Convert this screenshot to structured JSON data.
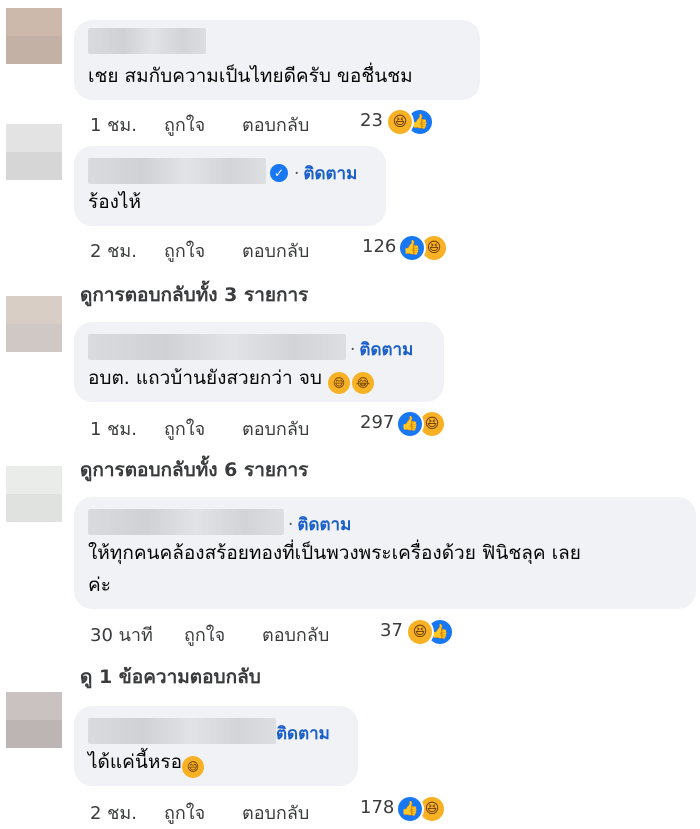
{
  "comments": [
    {
      "text": "เชย สมกับความเป็นไทยดีครับ ขอชื่นชม",
      "time": "1 ชม.",
      "like": "ถูกใจ",
      "reply": "ตอบกลับ",
      "reaction_count": "23"
    },
    {
      "follow": "ติดตาม",
      "text": "ร้องไห้",
      "time": "2 ชม.",
      "like": "ถูกใจ",
      "reply": "ตอบกลับ",
      "reaction_count": "126",
      "view_replies": "ดูการตอบกลับทั้ง 3 รายการ"
    },
    {
      "follow": "ติดตาม",
      "text": "อบต. แถวบ้านยังสวยกว่า จบ",
      "time": "1 ชม.",
      "like": "ถูกใจ",
      "reply": "ตอบกลับ",
      "reaction_count": "297",
      "view_replies": "ดูการตอบกลับทั้ง 6 รายการ"
    },
    {
      "follow": "ติดตาม",
      "text_line1": "ให้ทุกคนคล้องสร้อยทองที่เป็นพวงพระเครื่องด้วย ฟินิชลุค เลย",
      "text_line2": "ค่ะ",
      "time": "30 นาที",
      "like": "ถูกใจ",
      "reply": "ตอบกลับ",
      "reaction_count": "37",
      "view_replies": "ดู 1 ข้อความตอบกลับ"
    },
    {
      "follow": "ติดตาม",
      "text": "ได้แค่นี้หรอ",
      "time": "2 ชม.",
      "like": "ถูกใจ",
      "reply": "ตอบกลับ",
      "reaction_count": "178"
    }
  ],
  "icons": {
    "haha": "haha-reaction-icon",
    "like": "like-reaction-icon",
    "verified": "verified-badge-icon"
  },
  "colors": {
    "bubble": "#f0f2f5",
    "follow": "#1b5fc9",
    "like_blue": "#1877f2",
    "haha_yellow": "#f7b125"
  }
}
